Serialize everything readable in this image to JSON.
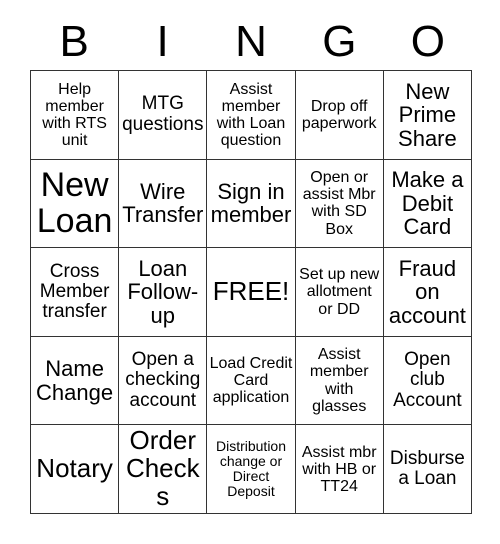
{
  "header": {
    "letters": [
      "B",
      "I",
      "N",
      "G",
      "O"
    ]
  },
  "grid": {
    "columns": 5,
    "rows": 5,
    "text_color": "#000000",
    "background_color": "#ffffff",
    "border_color": "#333333",
    "cells": [
      {
        "text": "Help member with RTS unit",
        "size": "fs-sm",
        "free": false
      },
      {
        "text": "MTG questions",
        "size": "fs-md",
        "free": false
      },
      {
        "text": "Assist member with Loan question",
        "size": "fs-sm",
        "free": false
      },
      {
        "text": "Drop off paperwork",
        "size": "fs-sm",
        "free": false
      },
      {
        "text": "New Prime Share",
        "size": "fs-lg",
        "free": false
      },
      {
        "text": "New Loan",
        "size": "fs-xxl",
        "free": false
      },
      {
        "text": "Wire Transfer",
        "size": "fs-lg",
        "free": false
      },
      {
        "text": "Sign in member",
        "size": "fs-lg",
        "free": false
      },
      {
        "text": "Open or assist Mbr with SD Box",
        "size": "fs-sm",
        "free": false
      },
      {
        "text": "Make a Debit Card",
        "size": "fs-lg",
        "free": false
      },
      {
        "text": "Cross Member transfer",
        "size": "fs-md",
        "free": false
      },
      {
        "text": "Loan Follow-up",
        "size": "fs-lg",
        "free": false
      },
      {
        "text": "FREE!",
        "size": "fs-xl",
        "free": true
      },
      {
        "text": "Set up new allotment or DD",
        "size": "fs-sm",
        "free": false
      },
      {
        "text": "Fraud on account",
        "size": "fs-lg",
        "free": false
      },
      {
        "text": "Name Change",
        "size": "fs-lg",
        "free": false
      },
      {
        "text": "Open a checking account",
        "size": "fs-md",
        "free": false
      },
      {
        "text": "Load Credit Card application",
        "size": "fs-sm",
        "free": false
      },
      {
        "text": "Assist member with glasses",
        "size": "fs-sm",
        "free": false
      },
      {
        "text": "Open club Account",
        "size": "fs-md",
        "free": false
      },
      {
        "text": "Notary",
        "size": "fs-xl",
        "free": false
      },
      {
        "text": "Order Checks",
        "size": "fs-xl",
        "free": false
      },
      {
        "text": "Distribution change or Direct Deposit",
        "size": "fs-xs",
        "free": false
      },
      {
        "text": "Assist mbr with HB or TT24",
        "size": "fs-sm",
        "free": false
      },
      {
        "text": "Disburse a Loan",
        "size": "fs-md",
        "free": false
      }
    ]
  }
}
